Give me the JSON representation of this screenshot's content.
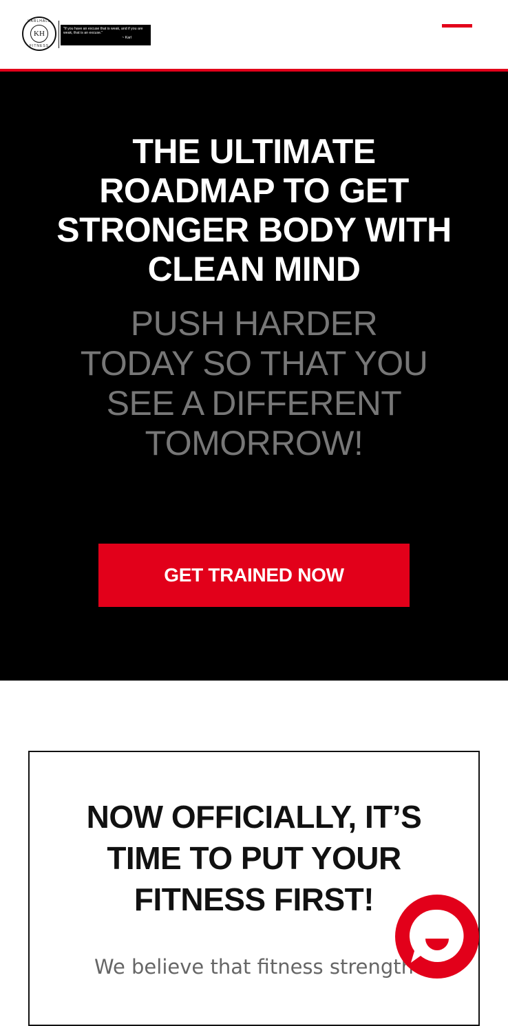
{
  "header": {
    "logo": {
      "monogram": "KH",
      "ring_top": "KARLHALL",
      "ring_bottom": "FITNESS"
    },
    "quote": {
      "text": "\"If you have an excuse that is weak, and if you are weak, that is an excuse.\"",
      "author": "~ Karl"
    },
    "menu_icon": "hamburger-icon"
  },
  "hero": {
    "title": "THE ULTIMATE ROADMAP TO GET STRONGER BODY WITH CLEAN MIND",
    "subtitle": "PUSH HARDER TODAY SO THAT YOU SEE A DIFFERENT TOMORROW!",
    "cta_label": "GET TRAINED NOW"
  },
  "section": {
    "title": "NOW OFFICIALLY, IT’S TIME TO PUT YOUR FITNESS FIRST!",
    "body": "We believe that fitness strength"
  },
  "chat_widget": {
    "icon": "chat-bubble-icon"
  },
  "colors": {
    "accent": "#e2001a",
    "hero_bg": "#000000",
    "subtitle_gray": "#777777"
  }
}
